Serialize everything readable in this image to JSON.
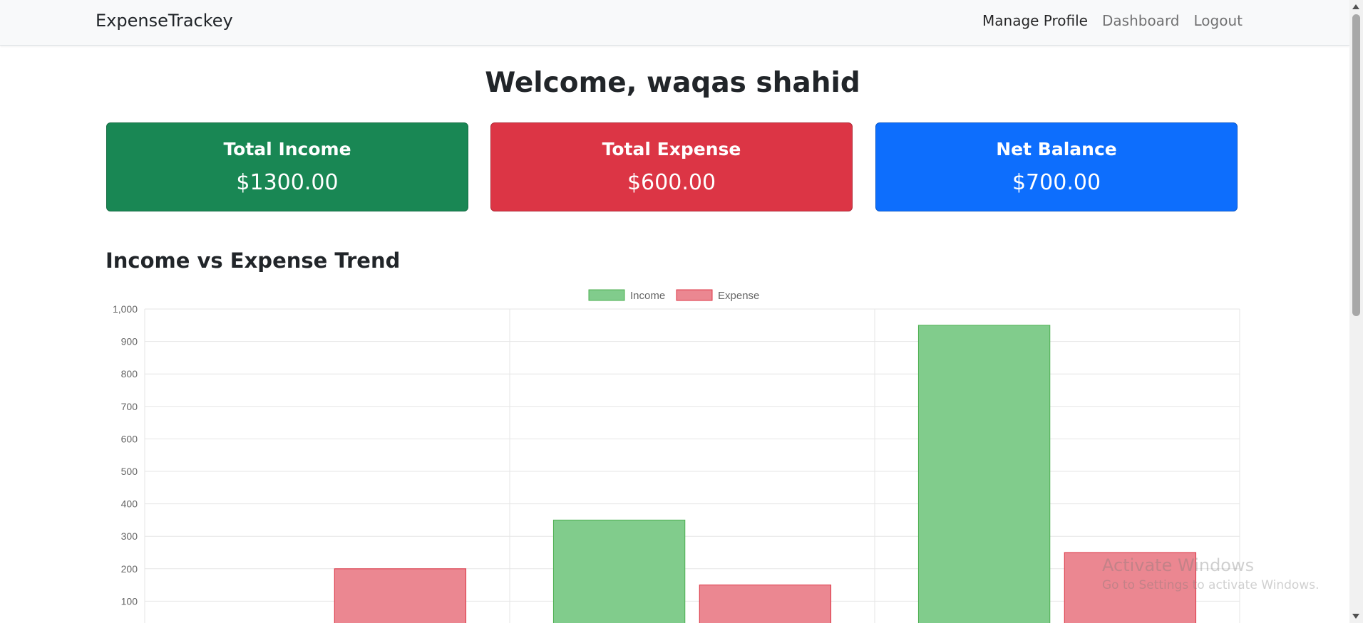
{
  "navbar": {
    "brand": "ExpenseTrackey",
    "links": [
      {
        "label": "Manage Profile"
      },
      {
        "label": "Dashboard"
      },
      {
        "label": "Logout"
      }
    ]
  },
  "welcome": "Welcome, waqas shahid",
  "cards": [
    {
      "title": "Total Income",
      "value": "$1300.00",
      "color": "#198754"
    },
    {
      "title": "Total Expense",
      "value": "$600.00",
      "color": "#dc3545"
    },
    {
      "title": "Net Balance",
      "value": "$700.00",
      "color": "#0d6efd"
    }
  ],
  "chart_title": "Income vs Expense Trend",
  "chart_data": {
    "type": "bar",
    "categories": [
      "",
      "",
      ""
    ],
    "series": [
      {
        "name": "Income",
        "values": [
          0,
          350,
          950
        ],
        "color": "#81cc8c",
        "border": "#4caf50"
      },
      {
        "name": "Expense",
        "values": [
          200,
          150,
          250
        ],
        "color": "#eb8791",
        "border": "#dc3545"
      }
    ],
    "ylim": [
      0,
      1000
    ],
    "yticks": [
      "1,000",
      "900",
      "800",
      "700",
      "600",
      "500",
      "400",
      "300",
      "200",
      "100"
    ],
    "ytick_values": [
      1000,
      900,
      800,
      700,
      600,
      500,
      400,
      300,
      200,
      100
    ],
    "grid": true,
    "legend": "top"
  },
  "watermark": {
    "line1": "Activate Windows",
    "line2": "Go to Settings to activate Windows."
  }
}
